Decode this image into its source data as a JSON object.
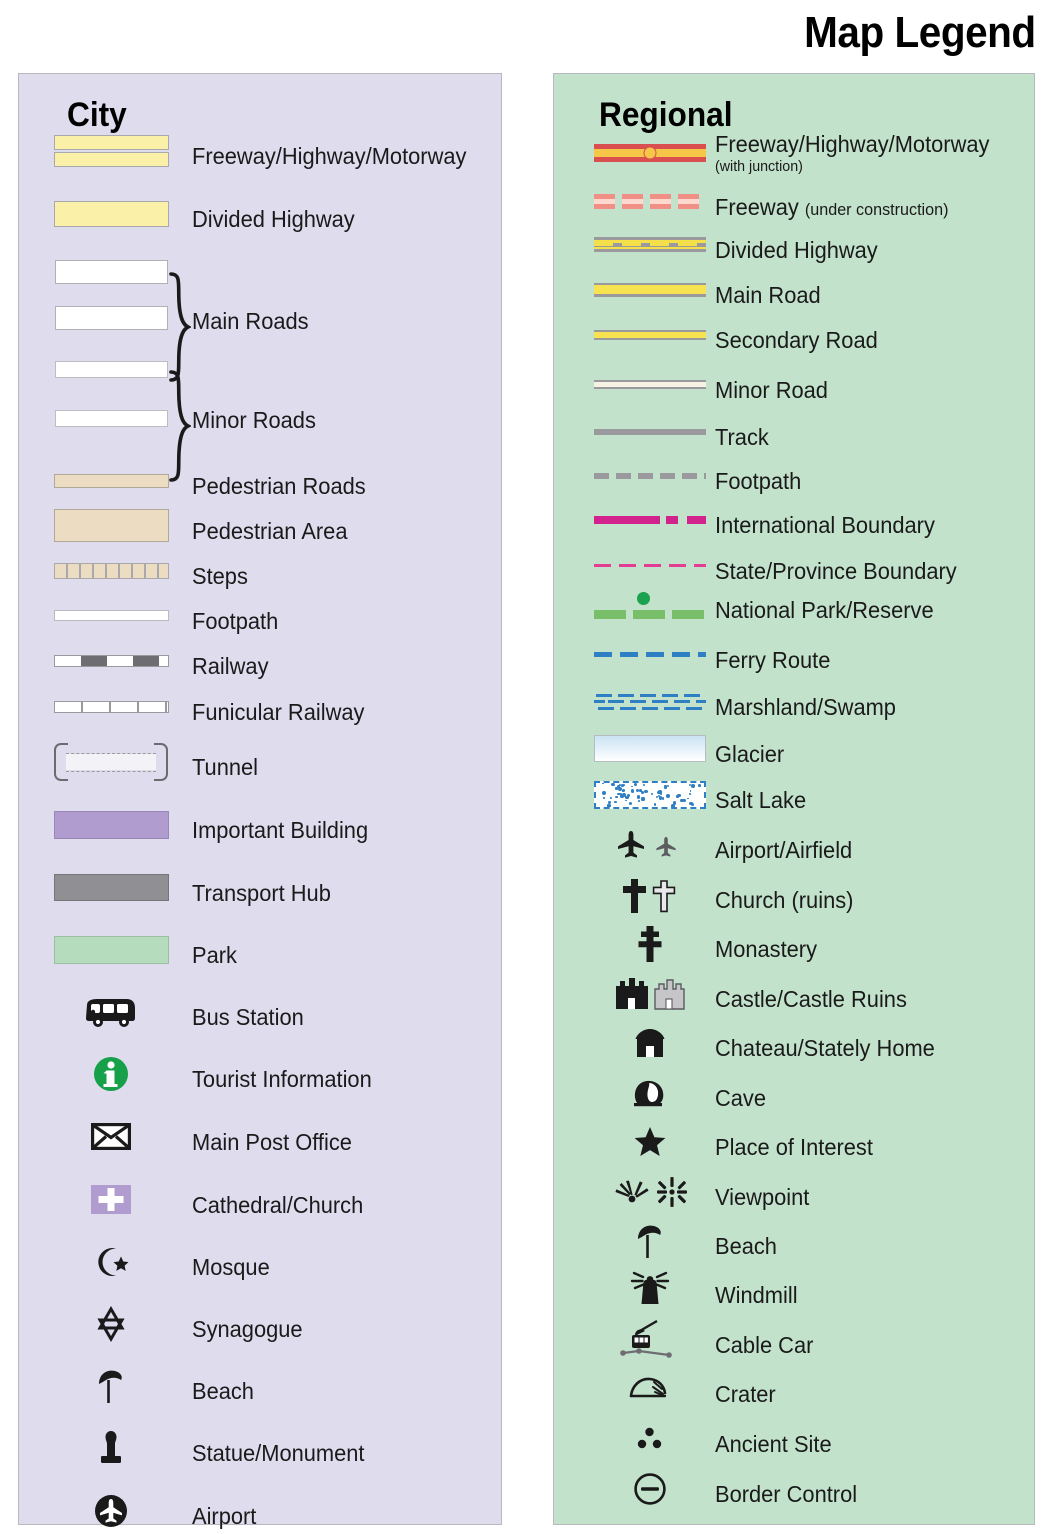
{
  "title": "Map Legend",
  "panels": {
    "city": {
      "heading": "City",
      "accent": "#dedced",
      "items": [
        {
          "label": "Freeway/Highway/Motorway",
          "symbol": "freeway-double-band",
          "color": "#fbf0a8"
        },
        {
          "label": "Divided Highway",
          "symbol": "divided-highway-band",
          "color": "#fbf0a8"
        },
        {
          "label": "Main Roads",
          "symbol": "main-roads-pair",
          "color": "#ffffff"
        },
        {
          "label": "Minor Roads",
          "symbol": "minor-roads-pair",
          "color": "#ffffff"
        },
        {
          "label": "Pedestrian Roads",
          "symbol": "pedestrian-road-band",
          "color": "#ecdcc2"
        },
        {
          "label": "Pedestrian Area",
          "symbol": "pedestrian-area-block",
          "color": "#ecdcc2"
        },
        {
          "label": "Steps",
          "symbol": "steps-hatched-band",
          "color": "#ecdcc2"
        },
        {
          "label": "Footpath",
          "symbol": "footpath-thin-line",
          "color": "#ffffff"
        },
        {
          "label": "Railway",
          "symbol": "railway-dashed-band",
          "color": "#6e6e72"
        },
        {
          "label": "Funicular Railway",
          "symbol": "funicular-ticked-line",
          "color": "#9a9a9e"
        },
        {
          "label": "Tunnel",
          "symbol": "tunnel-bracket-dashed",
          "color": "#6b6b70"
        },
        {
          "label": "Important Building",
          "symbol": "important-building-block",
          "color": "#b09cce"
        },
        {
          "label": "Transport Hub",
          "symbol": "transport-hub-block",
          "color": "#8f8f94"
        },
        {
          "label": "Park",
          "symbol": "park-block",
          "color": "#b5dcbc"
        },
        {
          "label": "Bus Station",
          "symbol": "bus-icon",
          "color": "#1a1a1a"
        },
        {
          "label": "Tourist Information",
          "symbol": "information-circle-icon",
          "color": "#16a04a"
        },
        {
          "label": "Main Post Office",
          "symbol": "envelope-icon",
          "color": "#1a1a1a"
        },
        {
          "label": "Cathedral/Church",
          "symbol": "cross-on-purple-icon",
          "color": "#b09cce"
        },
        {
          "label": "Mosque",
          "symbol": "crescent-star-icon",
          "color": "#1a1a1a"
        },
        {
          "label": "Synagogue",
          "symbol": "star-of-david-icon",
          "color": "#1a1a1a"
        },
        {
          "label": "Beach",
          "symbol": "beach-umbrella-icon",
          "color": "#1a1a1a"
        },
        {
          "label": "Statue/Monument",
          "symbol": "statue-icon",
          "color": "#1a1a1a"
        },
        {
          "label": "Airport",
          "symbol": "airport-circle-icon",
          "color": "#1a1a1a"
        }
      ]
    },
    "regional": {
      "heading": "Regional",
      "accent": "#c3e2cb",
      "items": [
        {
          "label": "Freeway/Highway/Motorway",
          "sublabel": "(with junction)",
          "sub_style": "below",
          "symbol": "freeway-junction-line",
          "color": "#d94f4f"
        },
        {
          "label": "Freeway",
          "sublabel": "(under construction)",
          "sub_style": "inline",
          "symbol": "freeway-construction-dashes",
          "color": "#f08f85"
        },
        {
          "label": "Divided Highway",
          "symbol": "divided-highway-line",
          "color": "#f5e04a"
        },
        {
          "label": "Main Road",
          "symbol": "main-road-line",
          "color": "#f7e34f"
        },
        {
          "label": "Secondary Road",
          "symbol": "secondary-road-line",
          "color": "#f7e34f"
        },
        {
          "label": "Minor Road",
          "symbol": "minor-road-line",
          "color": "#f6f2e4"
        },
        {
          "label": "Track",
          "symbol": "track-solid-line",
          "color": "#9a9a9e"
        },
        {
          "label": "Footpath",
          "symbol": "footpath-dashed-line",
          "color": "#9a9a9e"
        },
        {
          "label": "International Boundary",
          "symbol": "international-boundary-line",
          "color": "#d1238b"
        },
        {
          "label": "State/Province Boundary",
          "symbol": "state-boundary-dashed-line",
          "color": "#e33d96"
        },
        {
          "label": "National Park/Reserve",
          "symbol": "national-park-line",
          "color": "#79bf6a"
        },
        {
          "label": "Ferry Route",
          "symbol": "ferry-dashed-line",
          "color": "#2f7fc4"
        },
        {
          "label": "Marshland/Swamp",
          "symbol": "marshland-dashes",
          "color": "#2f7fc4"
        },
        {
          "label": "Glacier",
          "symbol": "glacier-gradient-block",
          "color": "#cbe3f4"
        },
        {
          "label": "Salt Lake",
          "symbol": "salt-lake-speckled-block",
          "color": "#2f7fc4"
        },
        {
          "label": "Airport/Airfield",
          "symbol": "airplane-pair-icon",
          "color": "#1a1a1a"
        },
        {
          "label": "Church (ruins)",
          "symbol": "cross-pair-icon",
          "color": "#1a1a1a"
        },
        {
          "label": "Monastery",
          "symbol": "monastery-cross-icon",
          "color": "#1a1a1a"
        },
        {
          "label": "Castle/Castle Ruins",
          "symbol": "castle-pair-icon",
          "color": "#1a1a1a"
        },
        {
          "label": "Chateau/Stately Home",
          "symbol": "chateau-icon",
          "color": "#1a1a1a"
        },
        {
          "label": "Cave",
          "symbol": "cave-icon",
          "color": "#1a1a1a"
        },
        {
          "label": "Place of Interest",
          "symbol": "star-icon",
          "color": "#1a1a1a"
        },
        {
          "label": "Viewpoint",
          "symbol": "viewpoint-pair-icon",
          "color": "#1a1a1a"
        },
        {
          "label": "Beach",
          "symbol": "beach-umbrella-icon",
          "color": "#1a1a1a"
        },
        {
          "label": "Windmill",
          "symbol": "windmill-icon",
          "color": "#1a1a1a"
        },
        {
          "label": "Cable Car",
          "symbol": "cable-car-icon",
          "color": "#1a1a1a"
        },
        {
          "label": "Crater",
          "symbol": "crater-icon",
          "color": "#1a1a1a"
        },
        {
          "label": "Ancient Site",
          "symbol": "ancient-site-dots-icon",
          "color": "#1a1a1a"
        },
        {
          "label": "Border Control",
          "symbol": "border-control-icon",
          "color": "#1a1a1a"
        }
      ]
    }
  }
}
